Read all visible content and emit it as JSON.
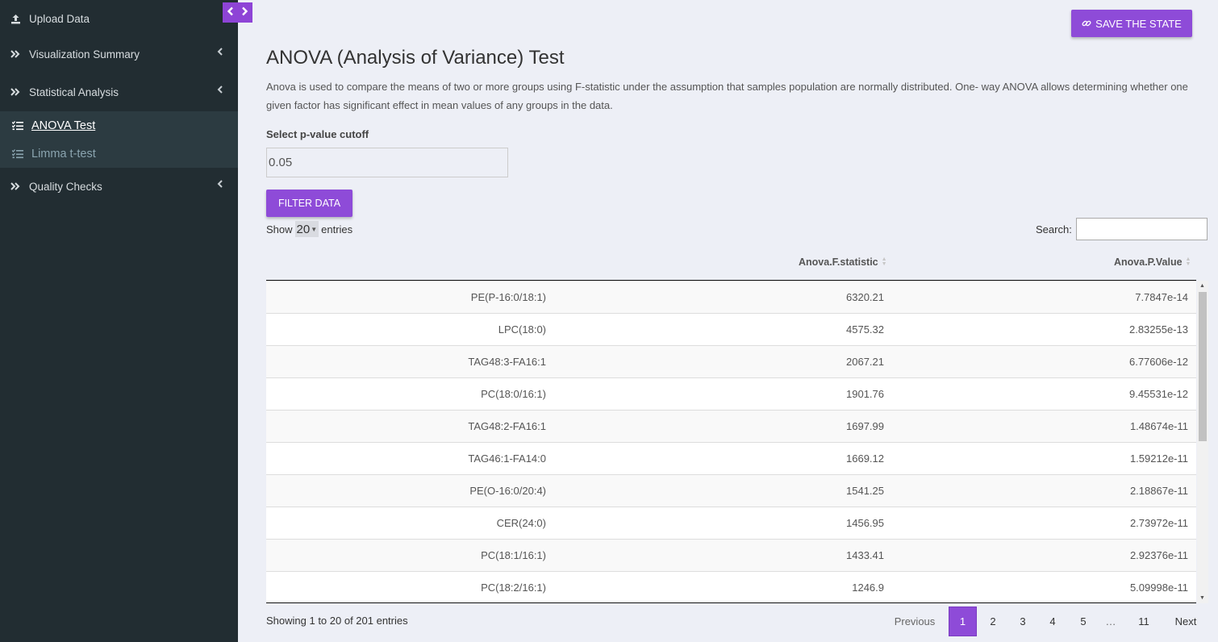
{
  "sidebar": {
    "items": [
      {
        "label": "Upload Data",
        "icon": "upload-icon"
      },
      {
        "label": "Visualization Summary",
        "icon": "double-chevron-right-icon"
      },
      {
        "label": "Statistical Analysis",
        "icon": "double-chevron-right-icon"
      },
      {
        "label": "Quality Checks",
        "icon": "double-chevron-right-icon"
      }
    ],
    "submenu": [
      {
        "label": "ANOVA Test",
        "icon": "list-check-icon",
        "active": true
      },
      {
        "label": "Limma t-test",
        "icon": "list-check-icon",
        "active": false
      }
    ]
  },
  "header": {
    "save_label": "SAVE THE STATE",
    "save_icon": "link-icon"
  },
  "main": {
    "title": "ANOVA (Analysis of Variance) Test",
    "description": "Anova is used to compare the means of two or more groups using F-statistic under the assumption that samples population are normally distributed. One- way ANOVA allows determining whether one given factor has significant effect in mean values of any groups in the data.",
    "pvalue_label": "Select p-value cutoff",
    "pvalue_value": "0.05",
    "filter_label": "FILTER DATA"
  },
  "table": {
    "show_prefix": "Show",
    "show_value": "20",
    "show_suffix": "entries",
    "search_label": "Search:",
    "columns": [
      "",
      "Anova.F.statistic",
      "Anova.P.Value"
    ],
    "rows": [
      [
        "PE(P-16:0/18:1)",
        "6320.21",
        "7.7847e-14"
      ],
      [
        "LPC(18:0)",
        "4575.32",
        "2.83255e-13"
      ],
      [
        "TAG48:3-FA16:1",
        "2067.21",
        "6.77606e-12"
      ],
      [
        "PC(18:0/16:1)",
        "1901.76",
        "9.45531e-12"
      ],
      [
        "TAG48:2-FA16:1",
        "1697.99",
        "1.48674e-11"
      ],
      [
        "TAG46:1-FA14:0",
        "1669.12",
        "1.59212e-11"
      ],
      [
        "PE(O-16:0/20:4)",
        "1541.25",
        "2.18867e-11"
      ],
      [
        "CER(24:0)",
        "1456.95",
        "2.73972e-11"
      ],
      [
        "PC(18:1/16:1)",
        "1433.41",
        "2.92376e-11"
      ],
      [
        "PC(18:2/16:1)",
        "1246.9",
        "5.09998e-11"
      ]
    ],
    "info": "Showing 1 to 20 of 201 entries",
    "pagination": {
      "previous": "Previous",
      "pages": [
        "1",
        "2",
        "3",
        "4",
        "5",
        "…",
        "11"
      ],
      "current": "1",
      "next": "Next"
    }
  },
  "colors": {
    "accent": "#8e4bd8",
    "sidebar_bg": "#222d32",
    "submenu_bg": "#2c3b41",
    "page_bg": "#edeff6"
  }
}
